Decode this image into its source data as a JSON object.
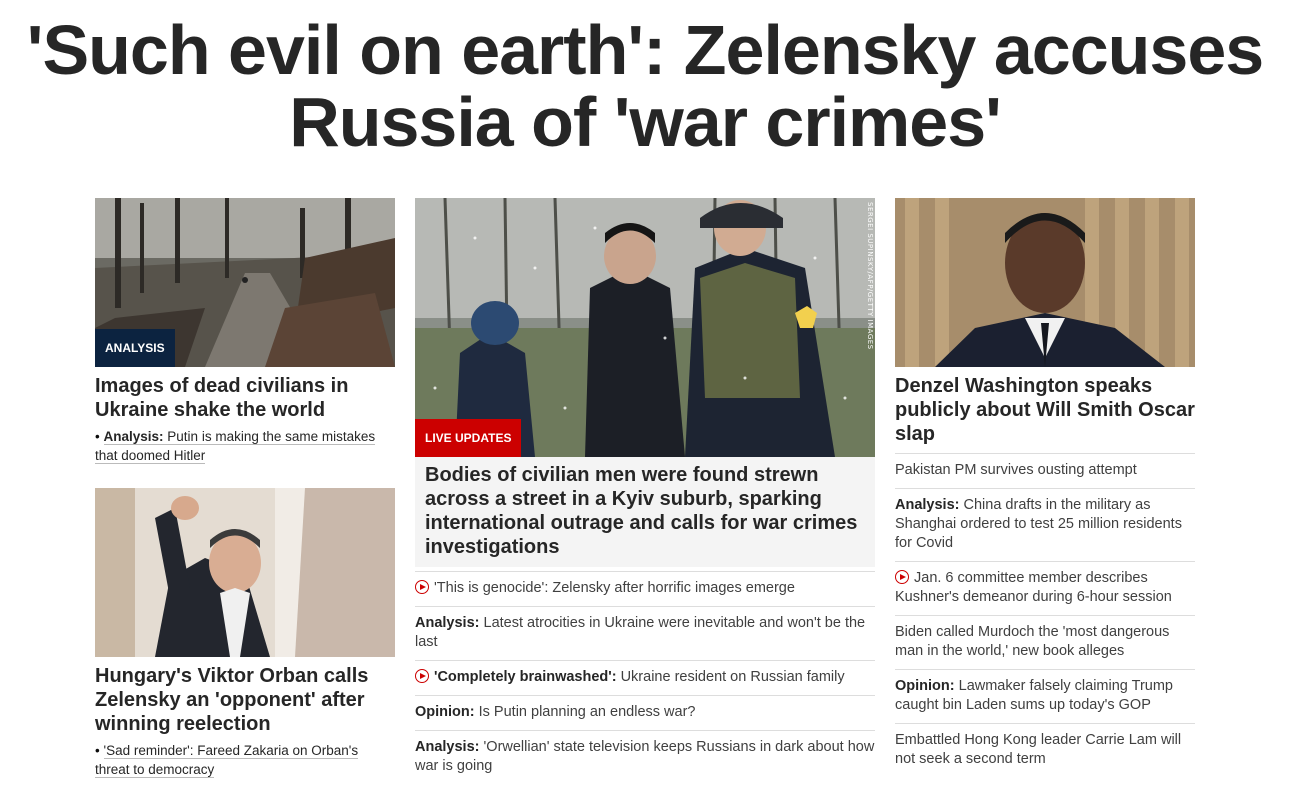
{
  "headline": "'Such evil on earth': Zelensky accuses Russia of 'war crimes'",
  "left": {
    "card1": {
      "image_icon": "ruined-street-photo",
      "badge": "ANALYSIS",
      "title": "Images of dead civilians in Ukraine shake the world",
      "sub_bullet": "•",
      "sub_prefix": "Analysis:",
      "sub_text": "Putin is making the same mistakes that doomed Hitler"
    },
    "card2": {
      "image_icon": "orban-waving-photo",
      "title": "Hungary's Viktor Orban calls Zelensky an 'opponent' after winning reelection",
      "sub_bullet": "•",
      "sub_text": "'Sad reminder': Fareed Zakaria on Orban's threat to democracy"
    }
  },
  "middle": {
    "image_icon": "soldiers-in-snow-photo",
    "credit": "SERGEI SUPINSKY/AFP/GETTY IMAGES",
    "badge": "LIVE UPDATES",
    "title": "Bodies of civilian men were found strewn across a street in a Kyiv suburb, sparking international outrage and calls for war crimes investigations",
    "items": [
      {
        "video": true,
        "prefix": "",
        "text": "'This is genocide': Zelensky after horrific images emerge"
      },
      {
        "video": false,
        "prefix": "Analysis:",
        "text": "Latest atrocities in Ukraine were inevitable and won't be the last"
      },
      {
        "video": true,
        "prefix": "'Completely brainwashed':",
        "text": "Ukraine resident on Russian family"
      },
      {
        "video": false,
        "prefix": "Opinion:",
        "text": "Is Putin planning an endless war?"
      },
      {
        "video": false,
        "prefix": "Analysis:",
        "text": "'Orwellian' state television keeps Russians in dark about how war is going"
      }
    ]
  },
  "right": {
    "image_icon": "denzel-washington-photo",
    "title": "Denzel Washington speaks publicly about Will Smith Oscar slap",
    "items": [
      {
        "video": false,
        "prefix": "",
        "text": "Pakistan PM survives ousting attempt"
      },
      {
        "video": false,
        "prefix": "Analysis:",
        "text": "China drafts in the military as Shanghai ordered to test 25 million residents for Covid"
      },
      {
        "video": true,
        "prefix": "",
        "text": "Jan. 6 committee member describes Kushner's demeanor during 6-hour session"
      },
      {
        "video": false,
        "prefix": "",
        "text": "Biden called Murdoch the 'most dangerous man in the world,' new book alleges"
      },
      {
        "video": false,
        "prefix": "Opinion:",
        "text": "Lawmaker falsely claiming Trump caught bin Laden sums up today's GOP"
      },
      {
        "video": false,
        "prefix": "",
        "text": "Embattled Hong Kong leader Carrie Lam will not seek a second term"
      }
    ]
  },
  "colors": {
    "live_red": "#cc0000",
    "analysis_navy": "#0c2340",
    "video_red": "#cc0000"
  }
}
